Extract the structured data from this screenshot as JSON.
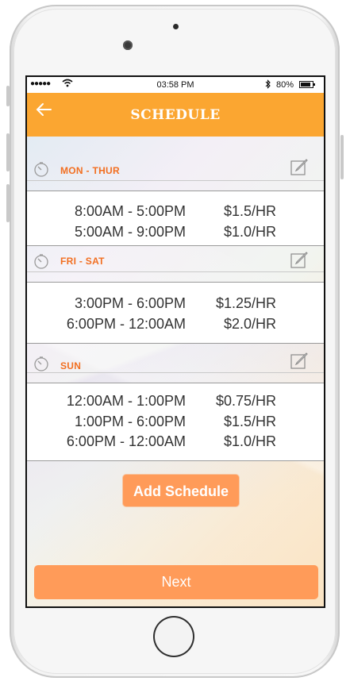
{
  "status_bar": {
    "signal": "●●●●●",
    "time": "03:58 PM",
    "battery_percent": "80%"
  },
  "header": {
    "title": "SCHEDULE",
    "back_icon": "arrow-left-icon"
  },
  "schedule": [
    {
      "day": "MON - THUR",
      "entries": [
        {
          "range": "8:00AM - 5:00PM",
          "rate": "$1.5/HR"
        },
        {
          "range": "5:00AM - 9:00PM",
          "rate": "$1.0/HR"
        }
      ]
    },
    {
      "day": "FRI - SAT",
      "entries": [
        {
          "range": "3:00PM - 6:00PM",
          "rate": "$1.25/HR"
        },
        {
          "range": "6:00PM - 12:00AM",
          "rate": "$2.0/HR"
        }
      ]
    },
    {
      "day": "SUN",
      "entries": [
        {
          "range": "12:00AM - 1:00PM",
          "rate": "$0.75/HR"
        },
        {
          "range": "1:00PM - 6:00PM",
          "rate": "$1.5/HR"
        },
        {
          "range": "6:00PM - 12:00AM",
          "rate": "$1.0/HR"
        }
      ]
    }
  ],
  "actions": {
    "add_schedule": "Add Schedule",
    "next": "Next"
  },
  "colors": {
    "accent": "#fba631",
    "day_label": "#f26f21",
    "button": "#ff9b59"
  }
}
